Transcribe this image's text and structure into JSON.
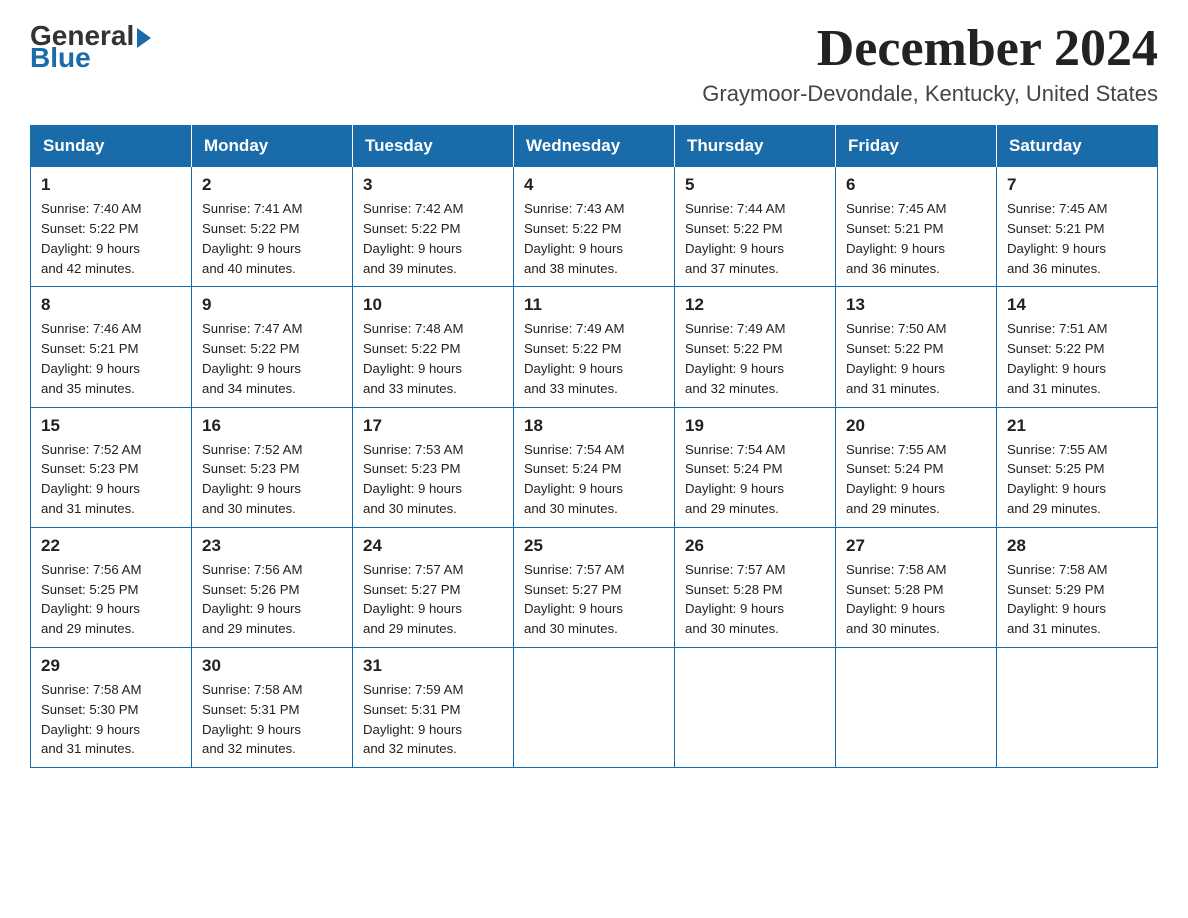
{
  "logo": {
    "general": "General",
    "blue": "Blue"
  },
  "header": {
    "title": "December 2024",
    "location": "Graymoor-Devondale, Kentucky, United States"
  },
  "days_of_week": [
    "Sunday",
    "Monday",
    "Tuesday",
    "Wednesday",
    "Thursday",
    "Friday",
    "Saturday"
  ],
  "weeks": [
    [
      {
        "day": "1",
        "sunrise": "7:40 AM",
        "sunset": "5:22 PM",
        "daylight": "9 hours and 42 minutes."
      },
      {
        "day": "2",
        "sunrise": "7:41 AM",
        "sunset": "5:22 PM",
        "daylight": "9 hours and 40 minutes."
      },
      {
        "day": "3",
        "sunrise": "7:42 AM",
        "sunset": "5:22 PM",
        "daylight": "9 hours and 39 minutes."
      },
      {
        "day": "4",
        "sunrise": "7:43 AM",
        "sunset": "5:22 PM",
        "daylight": "9 hours and 38 minutes."
      },
      {
        "day": "5",
        "sunrise": "7:44 AM",
        "sunset": "5:22 PM",
        "daylight": "9 hours and 37 minutes."
      },
      {
        "day": "6",
        "sunrise": "7:45 AM",
        "sunset": "5:21 PM",
        "daylight": "9 hours and 36 minutes."
      },
      {
        "day": "7",
        "sunrise": "7:45 AM",
        "sunset": "5:21 PM",
        "daylight": "9 hours and 36 minutes."
      }
    ],
    [
      {
        "day": "8",
        "sunrise": "7:46 AM",
        "sunset": "5:21 PM",
        "daylight": "9 hours and 35 minutes."
      },
      {
        "day": "9",
        "sunrise": "7:47 AM",
        "sunset": "5:22 PM",
        "daylight": "9 hours and 34 minutes."
      },
      {
        "day": "10",
        "sunrise": "7:48 AM",
        "sunset": "5:22 PM",
        "daylight": "9 hours and 33 minutes."
      },
      {
        "day": "11",
        "sunrise": "7:49 AM",
        "sunset": "5:22 PM",
        "daylight": "9 hours and 33 minutes."
      },
      {
        "day": "12",
        "sunrise": "7:49 AM",
        "sunset": "5:22 PM",
        "daylight": "9 hours and 32 minutes."
      },
      {
        "day": "13",
        "sunrise": "7:50 AM",
        "sunset": "5:22 PM",
        "daylight": "9 hours and 31 minutes."
      },
      {
        "day": "14",
        "sunrise": "7:51 AM",
        "sunset": "5:22 PM",
        "daylight": "9 hours and 31 minutes."
      }
    ],
    [
      {
        "day": "15",
        "sunrise": "7:52 AM",
        "sunset": "5:23 PM",
        "daylight": "9 hours and 31 minutes."
      },
      {
        "day": "16",
        "sunrise": "7:52 AM",
        "sunset": "5:23 PM",
        "daylight": "9 hours and 30 minutes."
      },
      {
        "day": "17",
        "sunrise": "7:53 AM",
        "sunset": "5:23 PM",
        "daylight": "9 hours and 30 minutes."
      },
      {
        "day": "18",
        "sunrise": "7:54 AM",
        "sunset": "5:24 PM",
        "daylight": "9 hours and 30 minutes."
      },
      {
        "day": "19",
        "sunrise": "7:54 AM",
        "sunset": "5:24 PM",
        "daylight": "9 hours and 29 minutes."
      },
      {
        "day": "20",
        "sunrise": "7:55 AM",
        "sunset": "5:24 PM",
        "daylight": "9 hours and 29 minutes."
      },
      {
        "day": "21",
        "sunrise": "7:55 AM",
        "sunset": "5:25 PM",
        "daylight": "9 hours and 29 minutes."
      }
    ],
    [
      {
        "day": "22",
        "sunrise": "7:56 AM",
        "sunset": "5:25 PM",
        "daylight": "9 hours and 29 minutes."
      },
      {
        "day": "23",
        "sunrise": "7:56 AM",
        "sunset": "5:26 PM",
        "daylight": "9 hours and 29 minutes."
      },
      {
        "day": "24",
        "sunrise": "7:57 AM",
        "sunset": "5:27 PM",
        "daylight": "9 hours and 29 minutes."
      },
      {
        "day": "25",
        "sunrise": "7:57 AM",
        "sunset": "5:27 PM",
        "daylight": "9 hours and 30 minutes."
      },
      {
        "day": "26",
        "sunrise": "7:57 AM",
        "sunset": "5:28 PM",
        "daylight": "9 hours and 30 minutes."
      },
      {
        "day": "27",
        "sunrise": "7:58 AM",
        "sunset": "5:28 PM",
        "daylight": "9 hours and 30 minutes."
      },
      {
        "day": "28",
        "sunrise": "7:58 AM",
        "sunset": "5:29 PM",
        "daylight": "9 hours and 31 minutes."
      }
    ],
    [
      {
        "day": "29",
        "sunrise": "7:58 AM",
        "sunset": "5:30 PM",
        "daylight": "9 hours and 31 minutes."
      },
      {
        "day": "30",
        "sunrise": "7:58 AM",
        "sunset": "5:31 PM",
        "daylight": "9 hours and 32 minutes."
      },
      {
        "day": "31",
        "sunrise": "7:59 AM",
        "sunset": "5:31 PM",
        "daylight": "9 hours and 32 minutes."
      },
      null,
      null,
      null,
      null
    ]
  ],
  "labels": {
    "sunrise_prefix": "Sunrise: ",
    "sunset_prefix": "Sunset: ",
    "daylight_prefix": "Daylight: "
  }
}
